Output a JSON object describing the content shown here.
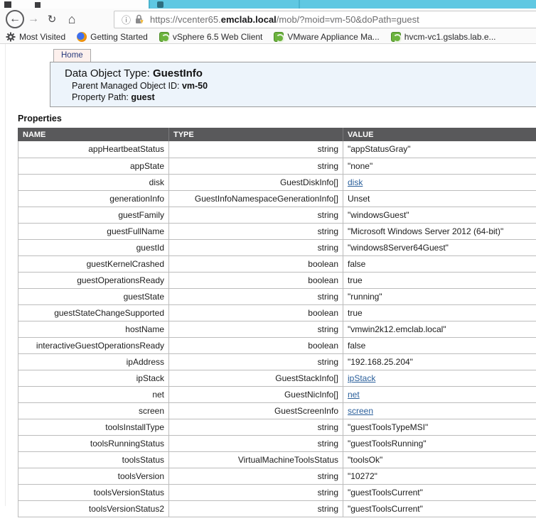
{
  "window": {
    "tabstrip_color": "#5fc8e2"
  },
  "browser": {
    "url": {
      "prefix": "https://vcenter65.",
      "domain": "emclab.local",
      "suffix": "/mob/?moid=vm-50&doPath=guest"
    },
    "bookmarks": [
      {
        "icon": "gear",
        "label": "Most Visited"
      },
      {
        "icon": "firefox",
        "label": "Getting Started"
      },
      {
        "icon": "vmware",
        "label": "vSphere 6.5 Web Client"
      },
      {
        "icon": "vmware",
        "label": "VMware Appliance Ma..."
      },
      {
        "icon": "vmware",
        "label": "hvcm-vc1.gslabs.lab.e..."
      }
    ]
  },
  "page": {
    "tab_label": "Home",
    "header": {
      "title_label": "Data Object Type: ",
      "title_value": "GuestInfo",
      "parent_label": "Parent Managed Object ID: ",
      "parent_value": "vm-50",
      "path_label": "Property Path: ",
      "path_value": "guest"
    },
    "section_title": "Properties",
    "table": {
      "columns": [
        "NAME",
        "TYPE",
        "VALUE"
      ],
      "rows": [
        {
          "name": "appHeartbeatStatus",
          "type": "string",
          "value": "\"appStatusGray\"",
          "link": false
        },
        {
          "name": "appState",
          "type": "string",
          "value": "\"none\"",
          "link": false
        },
        {
          "name": "disk",
          "type": "GuestDiskInfo[]",
          "value": "disk",
          "link": true
        },
        {
          "name": "generationInfo",
          "type": "GuestInfoNamespaceGenerationInfo[]",
          "value": "Unset",
          "link": false
        },
        {
          "name": "guestFamily",
          "type": "string",
          "value": "\"windowsGuest\"",
          "link": false
        },
        {
          "name": "guestFullName",
          "type": "string",
          "value": "\"Microsoft Windows Server 2012 (64-bit)\"",
          "link": false
        },
        {
          "name": "guestId",
          "type": "string",
          "value": "\"windows8Server64Guest\"",
          "link": false
        },
        {
          "name": "guestKernelCrashed",
          "type": "boolean",
          "value": "false",
          "link": false
        },
        {
          "name": "guestOperationsReady",
          "type": "boolean",
          "value": "true",
          "link": false
        },
        {
          "name": "guestState",
          "type": "string",
          "value": "\"running\"",
          "link": false
        },
        {
          "name": "guestStateChangeSupported",
          "type": "boolean",
          "value": "true",
          "link": false
        },
        {
          "name": "hostName",
          "type": "string",
          "value": "\"vmwin2k12.emclab.local\"",
          "link": false
        },
        {
          "name": "interactiveGuestOperationsReady",
          "type": "boolean",
          "value": "false",
          "link": false
        },
        {
          "name": "ipAddress",
          "type": "string",
          "value": "\"192.168.25.204\"",
          "link": false
        },
        {
          "name": "ipStack",
          "type": "GuestStackInfo[]",
          "value": "ipStack",
          "link": true
        },
        {
          "name": "net",
          "type": "GuestNicInfo[]",
          "value": "net",
          "link": true
        },
        {
          "name": "screen",
          "type": "GuestScreenInfo",
          "value": "screen",
          "link": true
        },
        {
          "name": "toolsInstallType",
          "type": "string",
          "value": "\"guestToolsTypeMSI\"",
          "link": false
        },
        {
          "name": "toolsRunningStatus",
          "type": "string",
          "value": "\"guestToolsRunning\"",
          "link": false
        },
        {
          "name": "toolsStatus",
          "type": "VirtualMachineToolsStatus",
          "value": "\"toolsOk\"",
          "link": false
        },
        {
          "name": "toolsVersion",
          "type": "string",
          "value": "\"10272\"",
          "link": false
        },
        {
          "name": "toolsVersionStatus",
          "type": "string",
          "value": "\"guestToolsCurrent\"",
          "link": false
        },
        {
          "name": "toolsVersionStatus2",
          "type": "string",
          "value": "\"guestToolsCurrent\"",
          "link": false
        }
      ]
    }
  }
}
